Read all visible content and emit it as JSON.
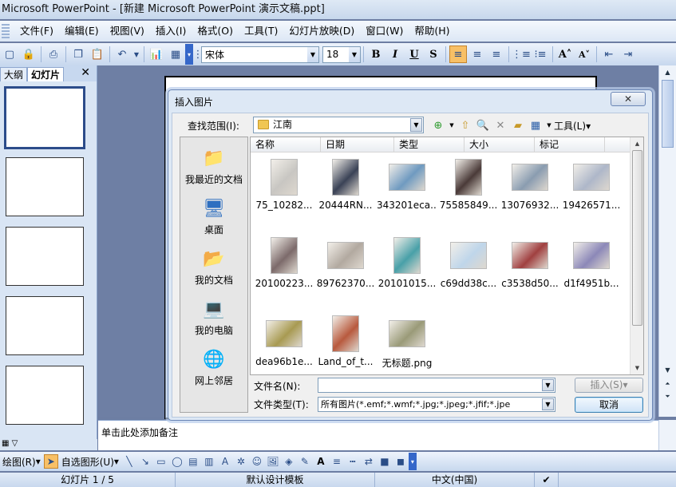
{
  "window": {
    "title": "Microsoft PowerPoint - [新建 Microsoft PowerPoint 演示文稿.ppt]"
  },
  "menu": [
    "文件(F)",
    "编辑(E)",
    "视图(V)",
    "插入(I)",
    "格式(O)",
    "工具(T)",
    "幻灯片放映(D)",
    "窗口(W)",
    "帮助(H)"
  ],
  "format": {
    "font": "宋体",
    "size": "18"
  },
  "pane": {
    "tab_outline": "大纲",
    "tab_slides": "幻灯片",
    "close": "✕",
    "slide_count": 5
  },
  "notes": {
    "placeholder": "单击此处添加备注"
  },
  "drawbar": {
    "draw": "绘图(R)",
    "autoshapes": "自选图形(U)"
  },
  "status": {
    "slide": "幻灯片 1 / 5",
    "template": "默认设计模板",
    "language": "中文(中国)"
  },
  "dialog": {
    "title": "插入图片",
    "look_in_label": "查找范围(I):",
    "look_in_value": "江南",
    "tools_label": "工具(L)",
    "columns": [
      "名称",
      "日期",
      "类型",
      "大小",
      "标记"
    ],
    "places": [
      "我最近的文档",
      "桌面",
      "我的文档",
      "我的电脑",
      "网上邻居"
    ],
    "files": [
      {
        "name": "75_10282...",
        "color": "#c8c6c2"
      },
      {
        "name": "20444RN...",
        "color": "#3a4256"
      },
      {
        "name": "343201eca...",
        "color": "#6f9ac0"
      },
      {
        "name": "75585849...",
        "color": "#4a3a38"
      },
      {
        "name": "13076932...",
        "color": "#8a9cb0"
      },
      {
        "name": "19426571...",
        "color": "#aeb7c9"
      },
      {
        "name": "20100223...",
        "color": "#7c6a6a"
      },
      {
        "name": "89762370...",
        "color": "#b2a9a0"
      },
      {
        "name": "20101015...",
        "color": "#48a0a8"
      },
      {
        "name": "c69dd38c...",
        "color": "#bfd6ea"
      },
      {
        "name": "c3538d50...",
        "color": "#a04040"
      },
      {
        "name": "d1f4951b...",
        "color": "#8c88b8"
      },
      {
        "name": "dea96b1e...",
        "color": "#a89a52"
      },
      {
        "name": "Land_of_t...",
        "color": "#b85a3e"
      },
      {
        "name": "无标题.png",
        "color": "#9a9a78"
      }
    ],
    "filename_label": "文件名(N):",
    "filename_value": "",
    "filetype_label": "文件类型(T):",
    "filetype_value": "所有图片(*.emf;*.wmf;*.jpg;*.jpeg;*.jfif;*.jpe",
    "insert_label": "插入(S)",
    "cancel_label": "取消"
  }
}
